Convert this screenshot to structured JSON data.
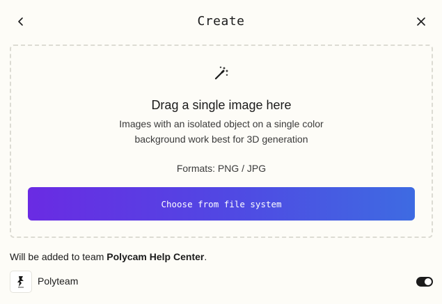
{
  "header": {
    "title": "Create",
    "back_icon": "chevron-left-icon",
    "close_icon": "close-icon"
  },
  "dropzone": {
    "icon": "magic-wand-icon",
    "title": "Drag a single image here",
    "description_line1": "Images with an isolated object on a single color",
    "description_line2": "background work best for 3D generation",
    "formats": "Formats: PNG / JPG",
    "button_label": "Choose from file system"
  },
  "team": {
    "prefix": "Will be added to team ",
    "team_name": "Polycam Help Center",
    "suffix": ".",
    "item_name": "Polyteam",
    "avatar_icon": "polyteam-logo-icon",
    "toggle_enabled": true
  },
  "colors": {
    "background": "#fdfcf7",
    "button_gradient_start": "#6a2be3",
    "button_gradient_end": "#3e6be2",
    "toggle_on": "#1b1b1b"
  }
}
